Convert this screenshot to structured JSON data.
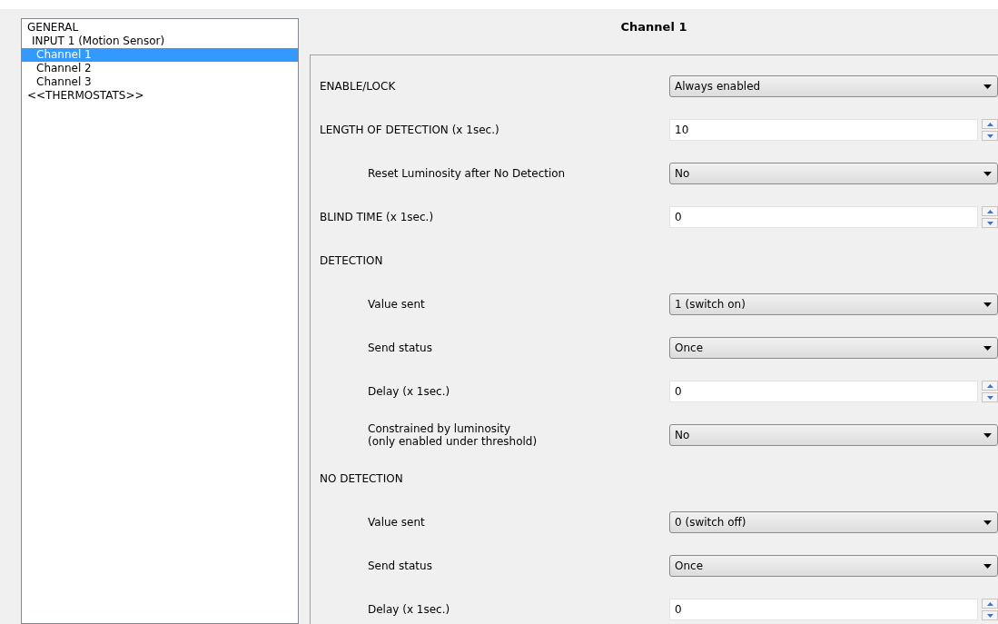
{
  "tree": {
    "items": [
      {
        "label": "GENERAL",
        "selected": false,
        "children": [
          {
            "label": "INPUT 1 (Motion Sensor)",
            "selected": false,
            "children": [
              {
                "label": "Channel 1",
                "selected": true
              },
              {
                "label": "Channel 2",
                "selected": false
              },
              {
                "label": "Channel 3",
                "selected": false
              }
            ]
          }
        ]
      },
      {
        "label": "<<THERMOSTATS>>",
        "selected": false
      }
    ]
  },
  "panel": {
    "title": "Channel 1",
    "rows": [
      {
        "kind": "dropdown",
        "label": "ENABLE/LOCK",
        "value": "Always enabled"
      },
      {
        "kind": "spin",
        "label": "LENGTH OF DETECTION (x 1sec.)",
        "value": "10",
        "children": [
          {
            "kind": "dropdown",
            "label": "Reset Luminosity after No Detection",
            "value": "No"
          }
        ]
      },
      {
        "kind": "spin",
        "label": "BLIND TIME (x 1sec.)",
        "value": "0"
      },
      {
        "kind": "section",
        "label": "DETECTION",
        "children": [
          {
            "kind": "dropdown",
            "label": "Value sent",
            "value": "1 (switch on)"
          },
          {
            "kind": "dropdown",
            "label": "Send status",
            "value": "Once"
          },
          {
            "kind": "spin",
            "label": "Delay (x 1sec.)",
            "value": "0"
          },
          {
            "kind": "dropdown",
            "label": "Constrained by luminosity\n(only enabled under threshold)",
            "value": "No"
          }
        ]
      },
      {
        "kind": "section",
        "label": "NO DETECTION",
        "children": [
          {
            "kind": "dropdown",
            "label": "Value sent",
            "value": "0 (switch off)"
          },
          {
            "kind": "dropdown",
            "label": "Send status",
            "value": "Once"
          },
          {
            "kind": "spin",
            "label": "Delay (x 1sec.)",
            "value": "0"
          }
        ]
      }
    ]
  }
}
